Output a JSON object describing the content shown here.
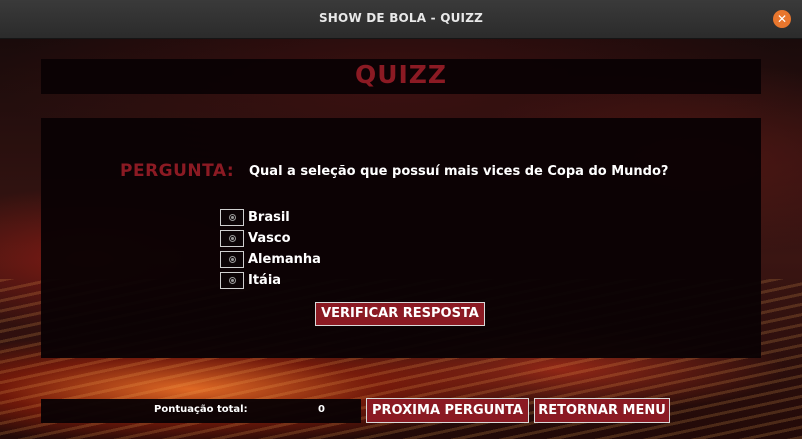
{
  "window": {
    "title": "SHOW DE BOLA - QUIZZ",
    "close_symbol": "✕",
    "accent_close": "#e8762d"
  },
  "header": {
    "title": "QUIZZ"
  },
  "question": {
    "label": "PERGUNTA:",
    "text": "Qual a seleção que possuí mais vices de Copa do Mundo?",
    "options": [
      {
        "label": "Brasil",
        "selected": false
      },
      {
        "label": "Vasco",
        "selected": false
      },
      {
        "label": "Alemanha",
        "selected": false
      },
      {
        "label": "Itáia",
        "selected": false
      }
    ],
    "verify_label": "VERIFICAR RESPOSTA"
  },
  "footer": {
    "score_label": "Pontuação total:",
    "score_value": "0",
    "next_label": "PROXIMA PERGUNTA",
    "menu_label": "RETORNAR MENU"
  },
  "colors": {
    "brand_red": "#8b1a23",
    "panel_bg": "#0a0204",
    "text": "#ffffff"
  },
  "icons": {
    "close": "close-icon",
    "radio": "radio-icon"
  }
}
